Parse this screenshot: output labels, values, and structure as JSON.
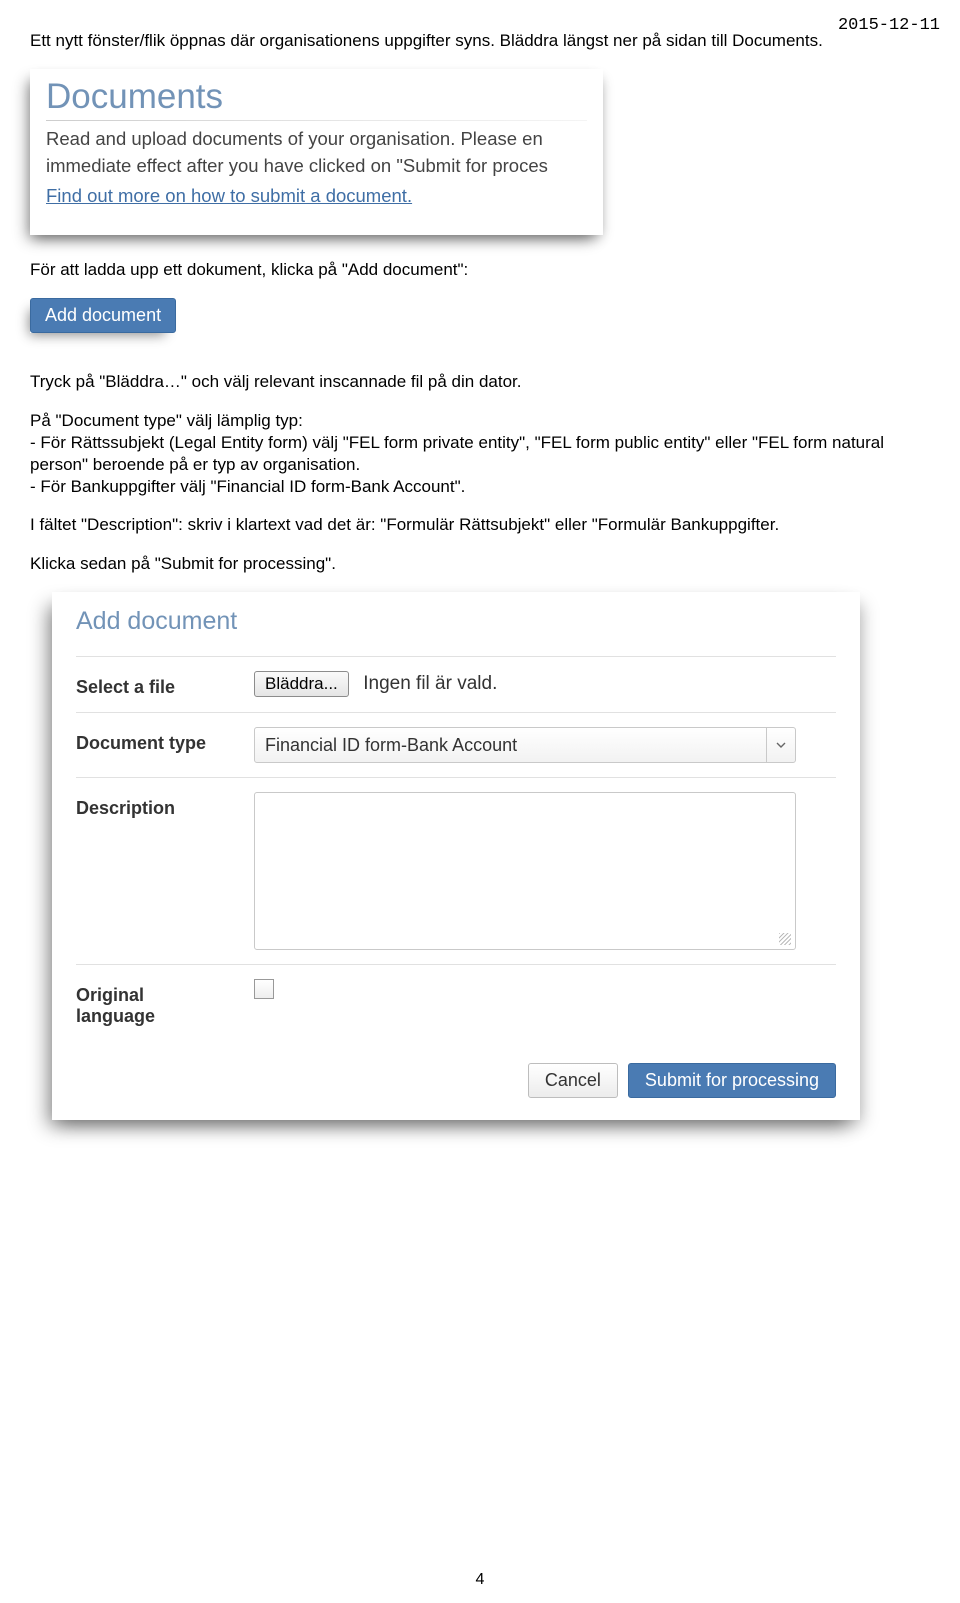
{
  "header": {
    "date": "2015-12-11"
  },
  "paragraphs": {
    "p1": "Ett nytt fönster/flik öppnas där organisationens uppgifter syns. Bläddra längst ner på sidan till Documents.",
    "p2": "För att ladda upp ett dokument, klicka på \"Add document\":",
    "p3": "Tryck på \"Bläddra…\" och välj relevant inscannade fil på din dator.",
    "p4a": "På \"Document type\" välj lämplig typ:",
    "p4b": "- För Rättssubjekt (Legal Entity form) välj \"FEL form private entity\", \"FEL form public entity\" eller \"FEL form natural person\" beroende på er typ av organisation.",
    "p4c": "- För Bankuppgifter välj \"Financial ID form-Bank Account\".",
    "p5": "I fältet \"Description\": skriv i klartext vad det är: \"Formulär Rättsubjekt\" eller \"Formulär Bankuppgifter.",
    "p6": "Klicka sedan på \"Submit for processing\"."
  },
  "documents_box": {
    "title": "Documents",
    "line1": "Read and upload documents of your organisation. Please en",
    "line2": "immediate effect after you have clicked on \"Submit for proces",
    "link": "Find out more on how to submit a document."
  },
  "buttons": {
    "add_document": "Add document",
    "cancel": "Cancel",
    "submit": "Submit for processing"
  },
  "form": {
    "title": "Add document",
    "labels": {
      "select_file": "Select a file",
      "doc_type": "Document type",
      "description": "Description",
      "orig_lang_1": "Original",
      "orig_lang_2": "language"
    },
    "file_button": "Bläddra...",
    "file_status": "Ingen fil är vald.",
    "doc_type_value": "Financial ID form-Bank Account"
  },
  "page_number": "4"
}
